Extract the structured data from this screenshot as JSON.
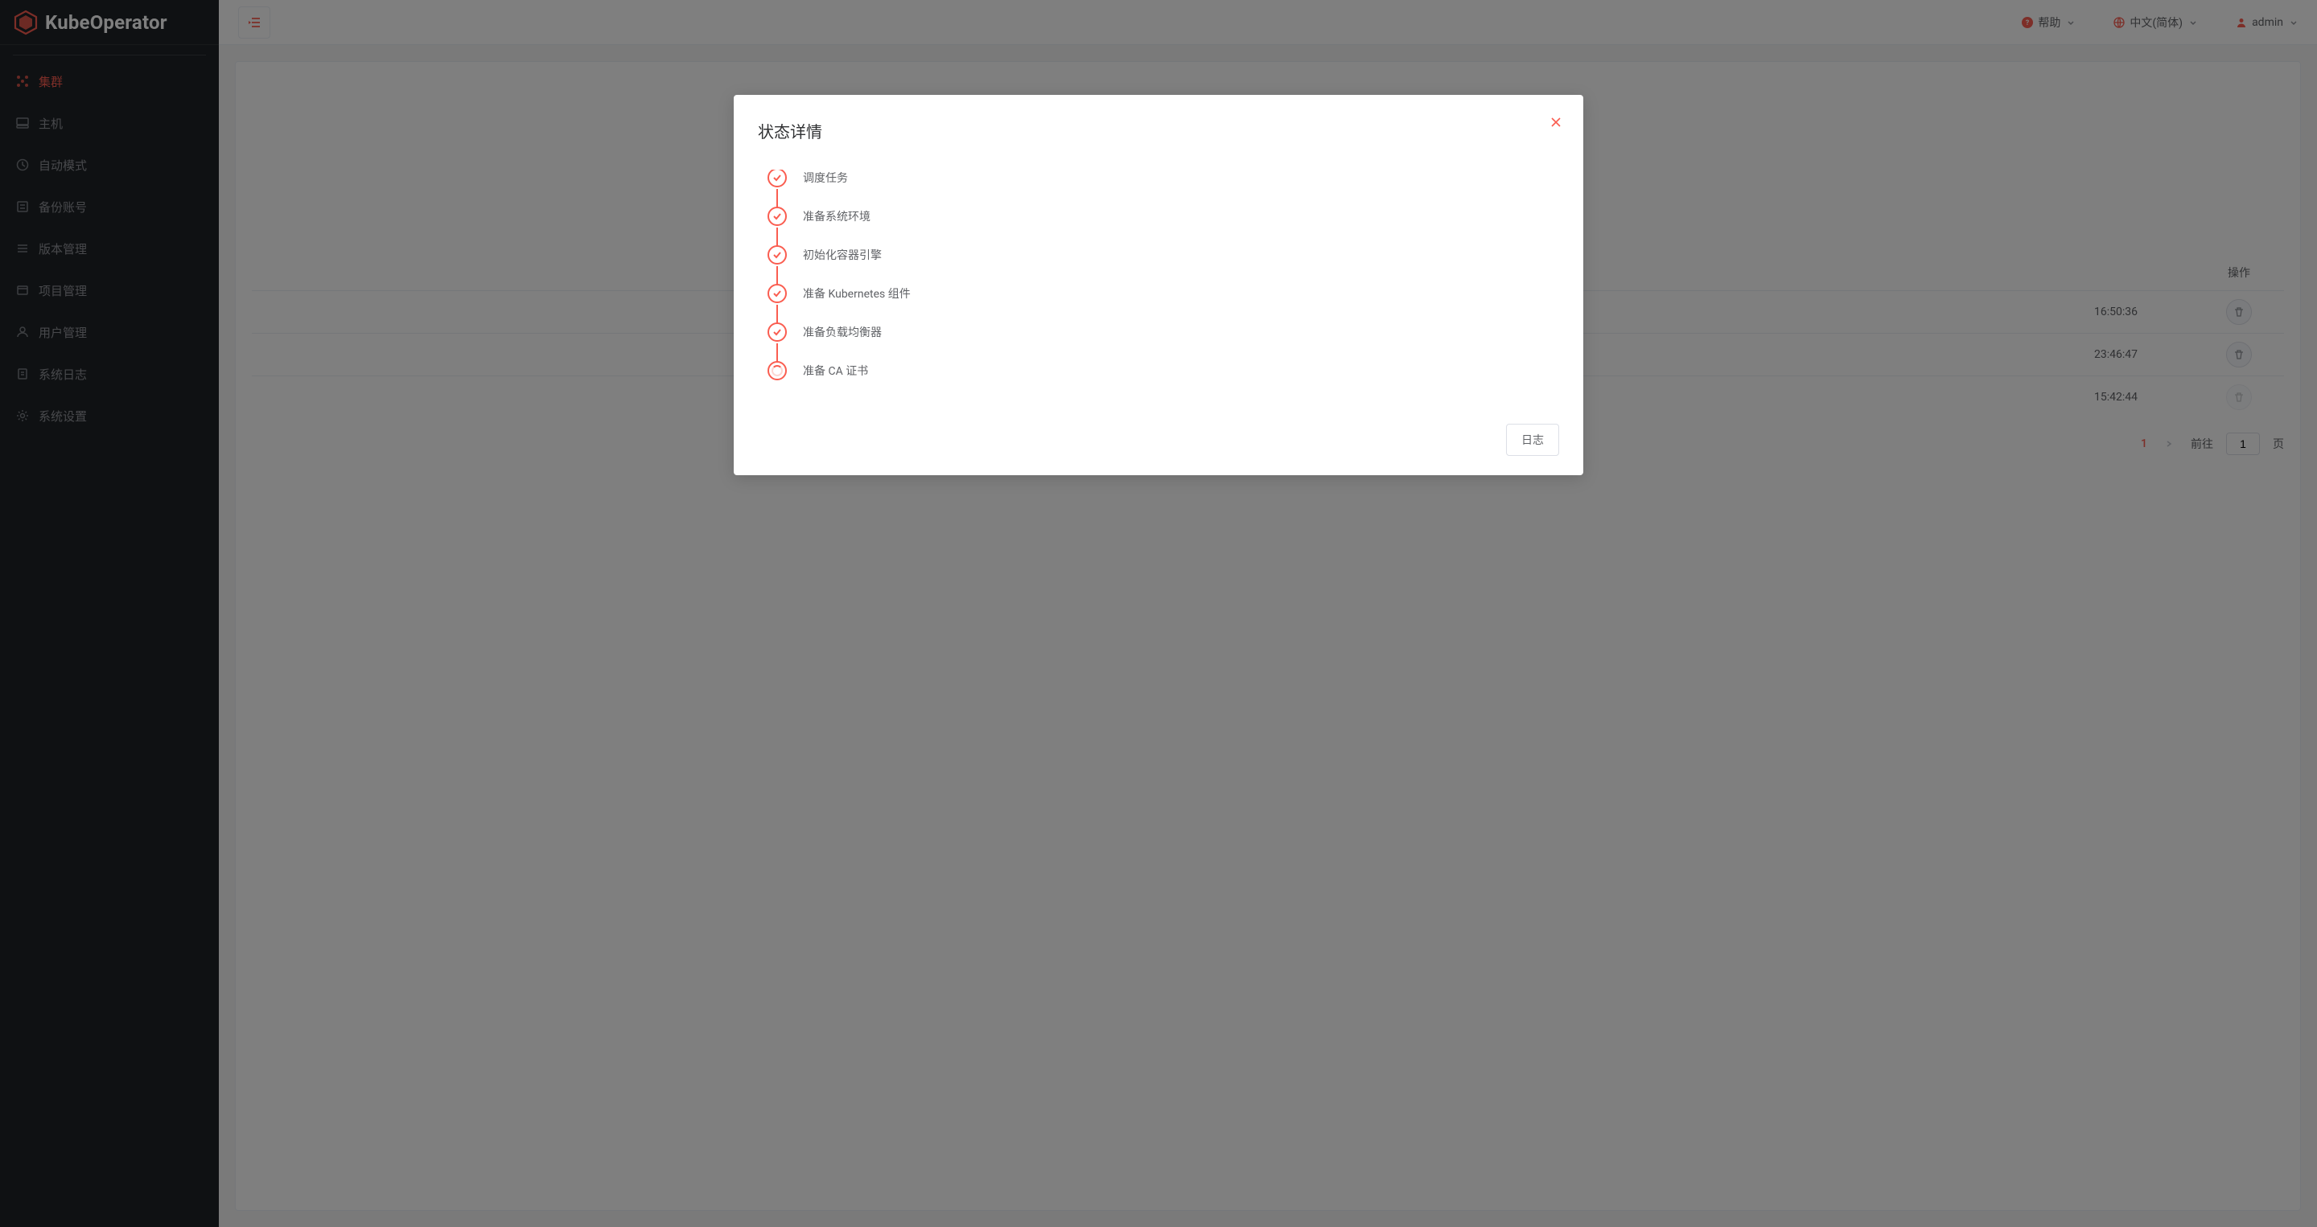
{
  "brand": {
    "name": "KubeOperator"
  },
  "sidebar": {
    "items": [
      {
        "label": "集群"
      },
      {
        "label": "主机"
      },
      {
        "label": "自动模式"
      },
      {
        "label": "备份账号"
      },
      {
        "label": "版本管理"
      },
      {
        "label": "项目管理"
      },
      {
        "label": "用户管理"
      },
      {
        "label": "系统日志"
      },
      {
        "label": "系统设置"
      }
    ]
  },
  "topbar": {
    "help": "帮助",
    "language": "中文(简体)",
    "user": "admin"
  },
  "table": {
    "col_action": "操作",
    "rows": [
      {
        "time": "16:50:36",
        "deleteDisabled": false
      },
      {
        "time": "23:46:47",
        "deleteDisabled": false
      },
      {
        "time": "15:42:44",
        "deleteDisabled": true
      }
    ]
  },
  "pagination": {
    "current": "1",
    "goto_label": "前往",
    "page_suffix": "页",
    "input_value": "1"
  },
  "modal": {
    "title": "状态详情",
    "steps": [
      {
        "label": "调度任务",
        "done": true
      },
      {
        "label": "准备系统环境",
        "done": true
      },
      {
        "label": "初始化容器引擎",
        "done": true
      },
      {
        "label": "准备 Kubernetes 组件",
        "done": true
      },
      {
        "label": "准备负载均衡器",
        "done": true
      },
      {
        "label": "准备 CA 证书",
        "done": false
      }
    ],
    "log_button": "日志"
  }
}
